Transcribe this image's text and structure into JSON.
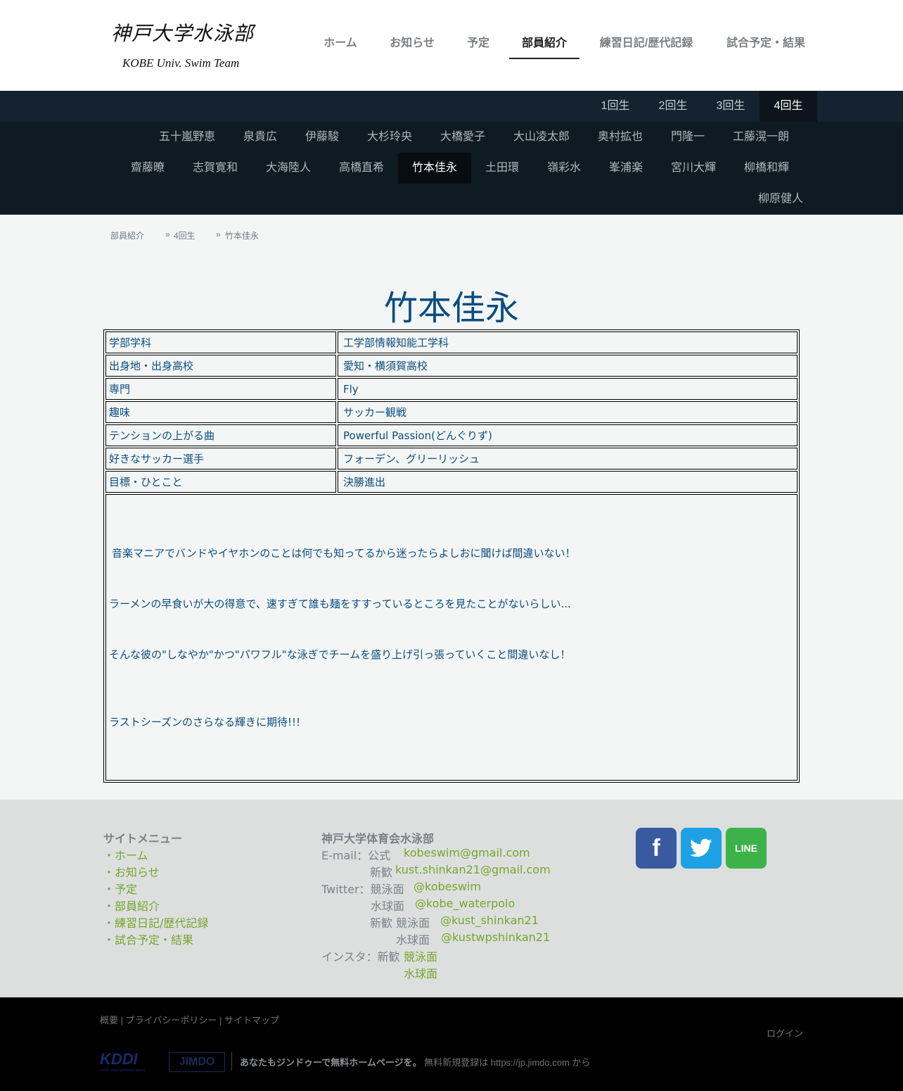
{
  "site": {
    "title": "神戸大学水泳部",
    "subtitle": "KOBE Univ. Swim Team"
  },
  "main_nav": {
    "items": [
      {
        "label": "ホーム"
      },
      {
        "label": "お知らせ"
      },
      {
        "label": "予定"
      },
      {
        "label": "部員紹介",
        "active": true
      },
      {
        "label": "練習日記/歴代記録"
      },
      {
        "label": "試合予定・結果"
      }
    ]
  },
  "grade_nav": {
    "items": [
      {
        "label": "1回生"
      },
      {
        "label": "2回生"
      },
      {
        "label": "3回生"
      },
      {
        "label": "4回生",
        "active": true
      }
    ]
  },
  "member_nav": {
    "row1": [
      "五十嵐野恵",
      "泉貴広",
      "伊藤駿",
      "大杉玲央",
      "大橋愛子",
      "大山凌太郎",
      "奥村拡也",
      "門隆一",
      "工藤滉一朗"
    ],
    "row2": [
      "齋藤暸",
      "志賀寛和",
      "大海陸人",
      "高橋直希",
      "竹本佳永",
      "土田環",
      "嶺彩水",
      "峯浦楽",
      "宮川大輝",
      "柳橋和輝"
    ],
    "row3": [
      "柳原健人"
    ],
    "active": "竹本佳永"
  },
  "breadcrumb": {
    "items": [
      "部員紹介",
      "»",
      "4回生",
      "»",
      "竹本佳永"
    ]
  },
  "page": {
    "title": "竹本佳永"
  },
  "profile": {
    "rows": [
      {
        "key": "学部学科",
        "value": "工学部情報知能工学科"
      },
      {
        "key": "出身地・出身高校",
        "value": "愛知・横須賀高校"
      },
      {
        "key": "専門",
        "value": "Fly"
      },
      {
        "key": "趣味",
        "value": "サッカー観戦"
      },
      {
        "key": "テンションの上がる曲",
        "value": "Powerful Passion(どんぐりず)"
      },
      {
        "key": "好きなサッカー選手",
        "value": "フォーデン、グリーリッシュ"
      },
      {
        "key": "目標・ひとこと",
        "value": "決勝進出"
      }
    ],
    "comment": [
      "音楽マニアでバンドやイヤホンのことは何でも知ってるから迷ったらよしおに聞けば間違いない！",
      "ラーメンの早食いが大の得意で、速すぎて誰も麺をすすっているところを見たことがないらしい...",
      "そんな彼の\"しなやか\"かつ\"パワフル\"な泳ぎでチームを盛り上げ引っ張っていくこと間違いなし！",
      "ラストシーズンのさらなる輝きに期待!!!"
    ]
  },
  "footer": {
    "menu_title": "サイトメニュー",
    "menu_items": [
      "・ホーム",
      "・お知らせ",
      "・予定",
      "・部員紹介",
      "・練習日記/歴代記録",
      "・試合予定・結果"
    ],
    "contact_title": "神戸大学体育会水泳部",
    "email_label": "E-mail：公式",
    "email_official": "kobeswim@gmail.com",
    "email_new_label": "新歓",
    "email_new": "kust.shinkan21@gmail.com",
    "twitter_label": "Twitter：競泳面",
    "twitter_swim": "@kobeswim",
    "twitter_wp_label": "水球面",
    "twitter_wp": "@kobe_waterpolo",
    "twitter_new_label": "新歓 競泳面",
    "twitter_new_swim": "@kust_shinkan21",
    "twitter_new_wp_label": "水球面",
    "twitter_new_wp": "@kustwpshinkan21",
    "insta_label": "インスタ：新歓",
    "insta_swim": "競泳面",
    "insta_wp": "水球面",
    "social": [
      {
        "name": "facebook",
        "glyph": "f",
        "color": "#3a5aa0"
      },
      {
        "name": "twitter",
        "color": "#1da1e4"
      },
      {
        "name": "line",
        "glyph": "LINE",
        "color": "#3db24a"
      }
    ]
  },
  "bottom_bar": {
    "links": "概要 | プライバシーポリシー | サイトマップ",
    "login": "ログイン",
    "kddi": "KDDI",
    "kddi_sub": "KDDI Web Communications",
    "jimdo": "JIMDO",
    "promo_bold": "あなたもジンドゥーで無料ホームページを。",
    "promo_rest": " 無料新規登録は https://jp.jimdo.com から"
  }
}
